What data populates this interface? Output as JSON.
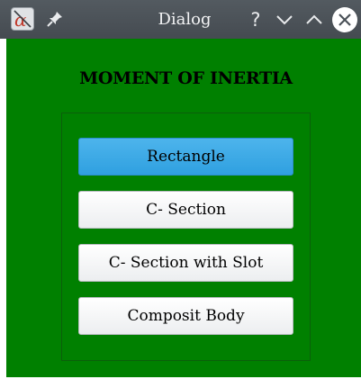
{
  "window": {
    "title": "Dialog",
    "icons": {
      "app": "app-icon",
      "pin": "pin-icon",
      "help": "?",
      "minimize": "chevron-down-icon",
      "maximize": "chevron-up-icon",
      "close": "close-icon"
    }
  },
  "dialog": {
    "heading": "MOMENT OF INERTIA",
    "buttons": [
      {
        "label": "Rectangle",
        "active": true
      },
      {
        "label": "C- Section",
        "active": false
      },
      {
        "label": "C- Section with Slot",
        "active": false
      },
      {
        "label": "Composit Body",
        "active": false
      }
    ]
  },
  "colors": {
    "background": "#008000",
    "titlebar": "#4a5157",
    "active_button": "#3aa8e6",
    "button": "#f5f5f5"
  }
}
